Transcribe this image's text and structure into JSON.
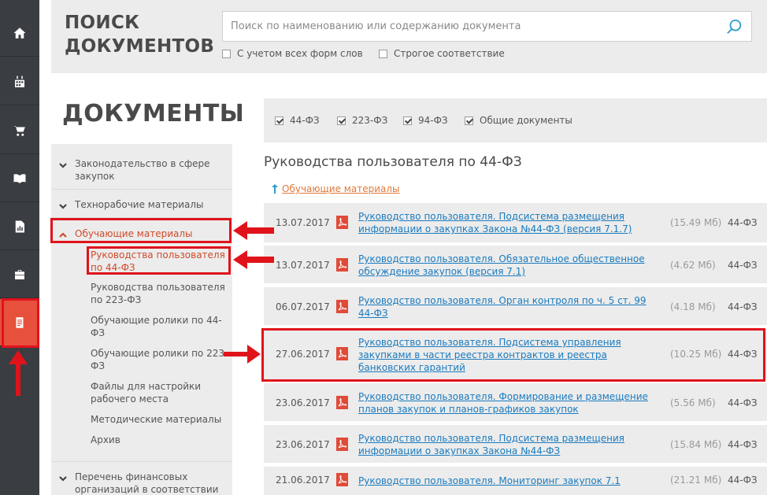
{
  "header": {
    "title_line1": "ПОИСК",
    "title_line2": "ДОКУМЕНТОВ",
    "search_placeholder": "Поиск по наименованию или содержанию документа",
    "option_all_forms": "С учетом всех форм слов",
    "option_strict": "Строгое соответствие"
  },
  "rail": {
    "icons": [
      "home-icon",
      "calendar-icon",
      "cart-icon",
      "book-icon",
      "report-icon",
      "briefcase-icon",
      "document-icon"
    ],
    "active_index": 6
  },
  "docs_title": "ДОКУМЕНТЫ",
  "nav": {
    "items": [
      {
        "label": "Законодательство в сфере закупок"
      },
      {
        "label": "Технорабочие материалы"
      },
      {
        "label": "Обучающие материалы"
      },
      {
        "label": "Перечень финансовых организаций в соответствии с"
      }
    ],
    "sub_items": [
      "Руководства пользователя по 44-ФЗ",
      "Руководства пользователя по 223-ФЗ",
      "Обучающие ролики по 44-ФЗ",
      "Обучающие ролики по 223-ФЗ",
      "Файлы для настройки рабочего места",
      "Методические материалы",
      "Архив"
    ]
  },
  "filters": [
    {
      "label": "44-ФЗ",
      "checked": true
    },
    {
      "label": "223-ФЗ",
      "checked": true
    },
    {
      "label": "94-ФЗ",
      "checked": true
    },
    {
      "label": "Общие документы",
      "checked": true
    }
  ],
  "section_title": "Руководства пользователя по 44-ФЗ",
  "back_link": "Обучающие материалы",
  "documents": [
    {
      "date": "13.07.2017",
      "title": "Руководство пользователя. Подсистема размещения информации о закупках Закона №44-ФЗ (версия 7.1.7)",
      "size": "(15.49 Мб)",
      "law": "44-ФЗ"
    },
    {
      "date": "13.07.2017",
      "title": "Руководство пользователя. Обязательное общественное обсуждение закупок (версия 7.1)",
      "size": "(4.62 Мб)",
      "law": "44-ФЗ"
    },
    {
      "date": "06.07.2017",
      "title": "Руководство пользователя. Орган контроля по ч. 5 ст. 99 44-ФЗ",
      "size": "(4.18 Мб)",
      "law": "44-ФЗ"
    },
    {
      "date": "27.06.2017",
      "title": "Руководство пользователя. Подсистема управления закупками в части реестра контрактов и реестра банковских гарантий",
      "size": "(10.25 Мб)",
      "law": "44-ФЗ"
    },
    {
      "date": "23.06.2017",
      "title": "Руководство пользователя. Формирование и размещение планов закупок и планов-графиков закупок",
      "size": "(5.56 Мб)",
      "law": "44-ФЗ"
    },
    {
      "date": "23.06.2017",
      "title": "Руководство пользователя. Подсистема размещения информации о закупках Закона №44-ФЗ",
      "size": "(15.84 Мб)",
      "law": "44-ФЗ"
    },
    {
      "date": "21.06.2017",
      "title": "Руководство пользователя. Мониторинг закупок 7.1",
      "size": "(21.21 Мб)",
      "law": "44-ФЗ"
    }
  ],
  "colors": {
    "rail_bg": "#3a3d42",
    "accent_active": "#e8503e",
    "link": "#1a7bbf",
    "annotation": "#e0131b"
  }
}
